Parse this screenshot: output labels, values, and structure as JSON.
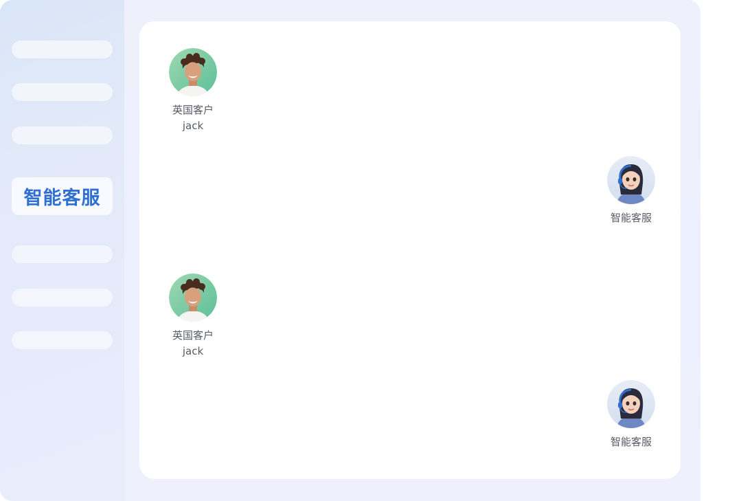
{
  "sidebar": {
    "items": [
      {
        "label": ""
      },
      {
        "label": ""
      },
      {
        "label": ""
      },
      {
        "label": "智能客服",
        "active": true
      },
      {
        "label": ""
      },
      {
        "label": ""
      },
      {
        "label": ""
      }
    ]
  },
  "chat": {
    "messages": [
      {
        "side": "left",
        "role": "customer",
        "avatar": "customer-avatar",
        "label": "英国客户",
        "sublabel": "jack"
      },
      {
        "side": "right",
        "role": "agent",
        "avatar": "agent-avatar",
        "label": "智能客服"
      },
      {
        "side": "left",
        "role": "customer",
        "avatar": "customer-avatar",
        "label": "英国客户",
        "sublabel": "jack"
      },
      {
        "side": "right",
        "role": "agent",
        "avatar": "agent-avatar",
        "label": "智能客服"
      }
    ]
  },
  "colors": {
    "accent": "#2f6fd0",
    "window_bg": "#eceffd",
    "sidebar_bg": "#dde7f8",
    "panel_bg": "#ffffff",
    "label_text": "#555a66"
  }
}
